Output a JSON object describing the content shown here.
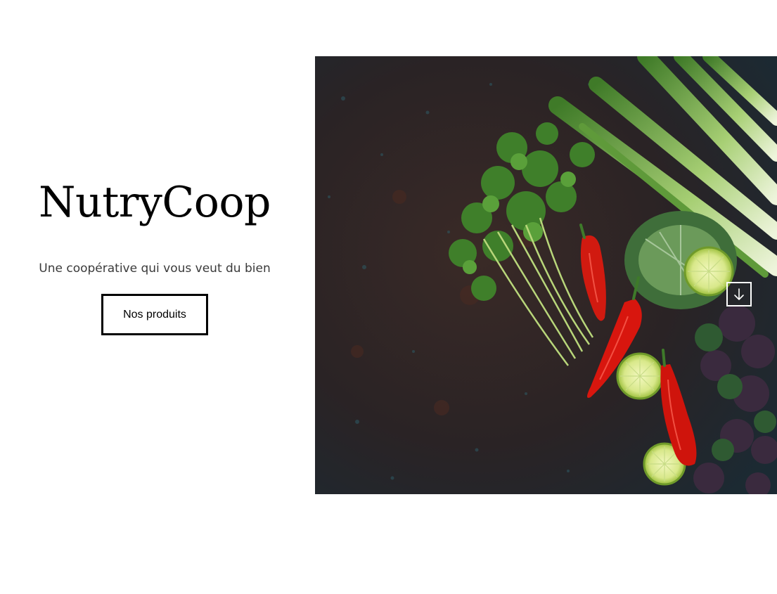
{
  "hero": {
    "title": "NutryCoop",
    "tagline": "Une coopérative qui vous veut du bien",
    "cta_label": "Nos produits",
    "image": {
      "subject": "fresh vegetables on dark stone surface",
      "icons": [
        "vegetables-photo"
      ]
    },
    "scroll_icon": "arrow-down-icon"
  },
  "colors": {
    "text": "#000000",
    "tagline": "#3a3a3a",
    "button_border": "#000000",
    "background": "#ffffff"
  }
}
